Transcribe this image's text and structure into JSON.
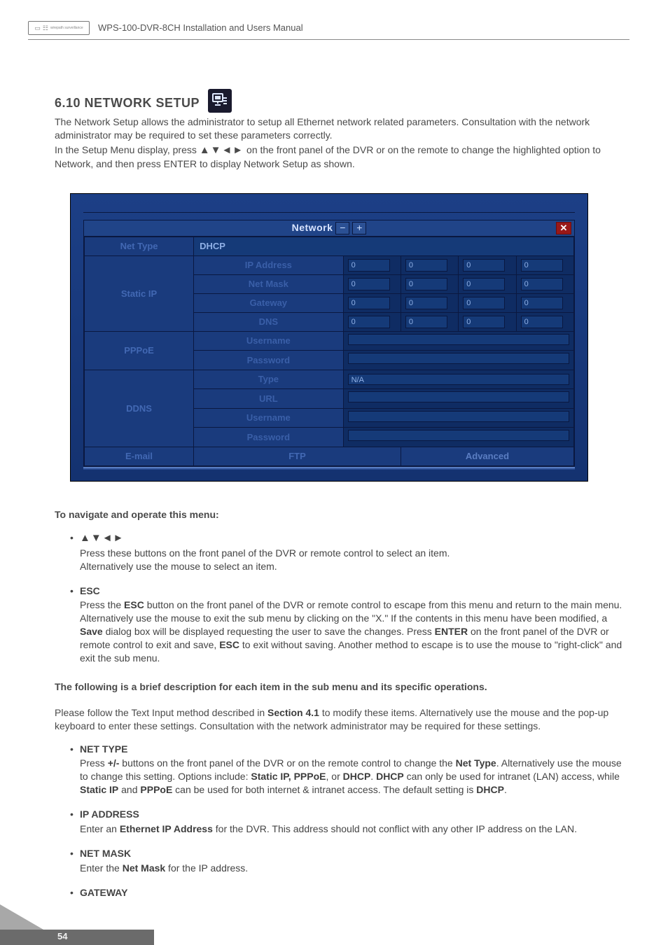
{
  "header": {
    "doc_title": "WPS-100-DVR-8CH Installation and Users Manual"
  },
  "section": {
    "heading": "6.10 NETWORK SETUP",
    "para1": "The Network Setup allows the administrator to setup all Ethernet network related parameters. Consultation with the network administrator may be required to set these parameters correctly.",
    "para2a": "In the Setup Menu display, press ",
    "para2_arrows": "▲▼◄►",
    "para2b": " on the front panel of the DVR or on the remote to change the highlighted option to Network, and then press ENTER to display Network Setup as shown."
  },
  "screenshot": {
    "title": "Network",
    "minus": "−",
    "plus": "+",
    "close": "✕",
    "net_type_label": "Net Type",
    "net_type_value": "DHCP",
    "static_ip": {
      "label": "Static IP",
      "rows": [
        {
          "label": "IP Address",
          "v": [
            "0",
            "0",
            "0",
            "0"
          ]
        },
        {
          "label": "Net Mask",
          "v": [
            "0",
            "0",
            "0",
            "0"
          ]
        },
        {
          "label": "Gateway",
          "v": [
            "0",
            "0",
            "0",
            "0"
          ]
        },
        {
          "label": "DNS",
          "v": [
            "0",
            "0",
            "0",
            "0"
          ]
        }
      ]
    },
    "pppoe": {
      "label": "PPPoE",
      "rows": [
        {
          "label": "Username",
          "v": ""
        },
        {
          "label": "Password",
          "v": ""
        }
      ]
    },
    "ddns": {
      "label": "DDNS",
      "rows": [
        {
          "label": "Type",
          "v": "N/A"
        },
        {
          "label": "URL",
          "v": ""
        },
        {
          "label": "Username",
          "v": ""
        },
        {
          "label": "Password",
          "v": ""
        }
      ]
    },
    "footer": {
      "email": "E-mail",
      "ftp": "FTP",
      "advanced": "Advanced"
    }
  },
  "navigate": {
    "heading": "To navigate and operate this menu:",
    "arrow_bullet": "▲▼◄►",
    "arrow_desc1": "Press these buttons on the front panel of the DVR or remote control to select an item.",
    "arrow_desc2": "Alternatively use the mouse to select an item.",
    "esc_title": "ESC",
    "esc_a": "Press the ",
    "esc_b": "ESC",
    "esc_c": " button on the front panel of the DVR or remote control to escape from this menu and return to the main menu.  Alternatively use the mouse to exit the sub menu by clicking on the \"X.\"  If the contents in this menu have been modified, a ",
    "esc_d": "Save",
    "esc_e": " dialog box will be displayed requesting the user to save the changes.  Press ",
    "esc_f": "ENTER",
    "esc_g": " on the front panel of the DVR or remote control to exit and save, ",
    "esc_h": "ESC",
    "esc_i": " to exit without saving.  Another method to escape is to use the mouse to \"right-click\" and exit the sub menu."
  },
  "brief": {
    "heading": "The following is a brief description for each item in the sub menu and its specific operations.",
    "intro_a": "Please follow the Text Input method described in ",
    "intro_b": "Section 4.1",
    "intro_c": " to modify these items.  Alternatively use the mouse and the pop-up keyboard to enter these settings.  Consultation with the network administrator may be required for these settings.",
    "items": {
      "net_type": {
        "title": "NET TYPE",
        "a": "Press ",
        "b": "+/-",
        "c": " buttons on the front panel of the DVR or on the remote control to change the ",
        "d": "Net Type",
        "e": ".  Alternatively use the mouse to change this setting.  Options include: ",
        "f": "Static IP, PPPoE",
        "g": ", or ",
        "h": "DHCP",
        "i": ".  ",
        "j": "DHCP",
        "k": " can only be used for intranet (LAN) access, while ",
        "l": "Static IP",
        "m": " and ",
        "n": "PPPoE",
        "o": " can be used for both internet & intranet access.  The default setting is ",
        "p": "DHCP",
        "q": "."
      },
      "ip_address": {
        "title": "IP ADDRESS",
        "a": "Enter an ",
        "b": "Ethernet IP Address",
        "c": " for the DVR.  This address should not conflict with any other IP address on the LAN."
      },
      "net_mask": {
        "title": "NET MASK",
        "a": "Enter the ",
        "b": "Net Mask",
        "c": " for the IP address."
      },
      "gateway": {
        "title": "GATEWAY"
      }
    }
  },
  "page_number": "54"
}
